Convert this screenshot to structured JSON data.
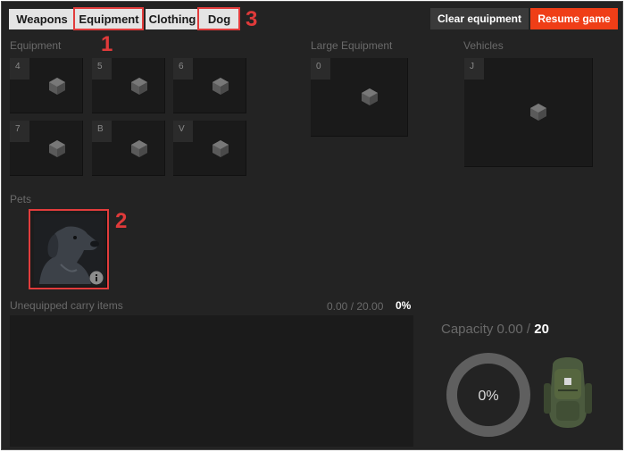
{
  "tabs": {
    "weapons": "Weapons",
    "equipment": "Equipment",
    "clothing": "Clothing",
    "dog": "Dog"
  },
  "actions": {
    "clear_equipment": "Clear equipment",
    "resume_game": "Resume game"
  },
  "sections": {
    "equipment": "Equipment",
    "large_equipment": "Large Equipment",
    "vehicles": "Vehicles",
    "pets": "Pets",
    "unequipped": "Unequipped carry items"
  },
  "equipment_slots": [
    "4",
    "5",
    "6",
    "7",
    "B",
    "V"
  ],
  "large_equipment_slot": "0",
  "vehicle_slot": "J",
  "carry": {
    "weight": "0.00 / 20.00",
    "percent": "0%"
  },
  "capacity": {
    "label": "Capacity 0.00 / ",
    "max": "20",
    "gauge_text": "0%",
    "fill_fraction": 0
  },
  "annotations": [
    "1",
    "2",
    "3"
  ],
  "colors": {
    "resume_button": "#ef3e17",
    "annotation": "#e23c3c",
    "clear_button": "#3a3a3a"
  },
  "icons": {
    "empty_slot": "cube-icon",
    "pet_info": "info-icon",
    "pet": "dog-portrait",
    "backpack": "backpack-image"
  }
}
